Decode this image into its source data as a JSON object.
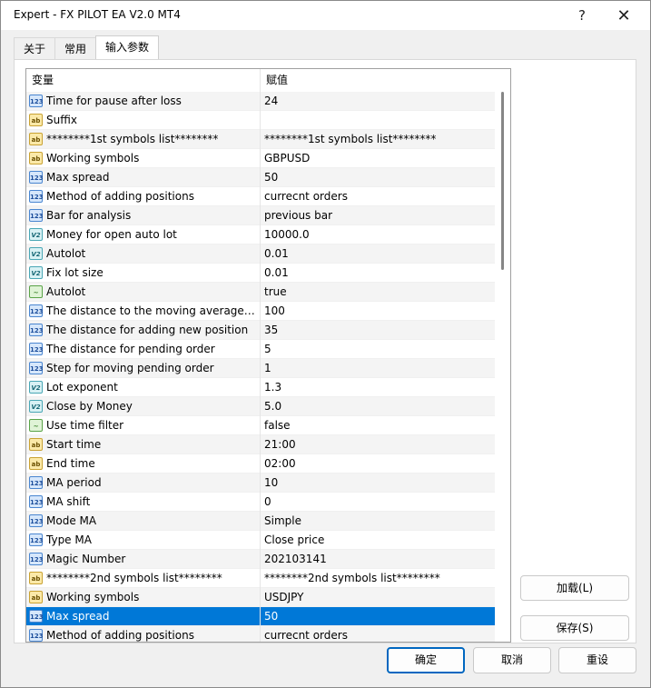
{
  "window": {
    "title": "Expert - FX PILOT EA V2.0 MT4",
    "help_glyph": "?",
    "close_glyph": "✕"
  },
  "tabs": [
    {
      "label": "关于"
    },
    {
      "label": "常用"
    },
    {
      "label": "输入参数"
    }
  ],
  "active_tab": 2,
  "grid": {
    "header": {
      "variable": "变量",
      "value": "赋值"
    },
    "selected_row": 27,
    "rows": [
      {
        "type": "int",
        "icon": "integer-type-icon",
        "name": "Time for pause after loss",
        "value": "24"
      },
      {
        "type": "str",
        "icon": "string-type-icon",
        "name": "Suffix",
        "value": ""
      },
      {
        "type": "str",
        "icon": "string-type-icon",
        "name": "********1st symbols list********",
        "value": "********1st symbols list********"
      },
      {
        "type": "str",
        "icon": "string-type-icon",
        "name": "Working symbols",
        "value": "GBPUSD"
      },
      {
        "type": "int",
        "icon": "integer-type-icon",
        "name": "Max spread",
        "value": "50"
      },
      {
        "type": "int",
        "icon": "integer-type-icon",
        "name": "Method of adding positions",
        "value": "currecnt orders"
      },
      {
        "type": "int",
        "icon": "integer-type-icon",
        "name": "Bar for analysis",
        "value": "previous bar"
      },
      {
        "type": "dbl",
        "icon": "double-type-icon",
        "name": "Money for open auto lot",
        "value": "10000.0"
      },
      {
        "type": "dbl",
        "icon": "double-type-icon",
        "name": "Autolot",
        "value": "0.01"
      },
      {
        "type": "dbl",
        "icon": "double-type-icon",
        "name": "Fix lot size",
        "value": "0.01"
      },
      {
        "type": "bool",
        "icon": "boolean-type-icon",
        "name": "Autolot",
        "value": "true"
      },
      {
        "type": "int",
        "icon": "integer-type-icon",
        "name": "The distance to the moving average o...",
        "value": "100"
      },
      {
        "type": "int",
        "icon": "integer-type-icon",
        "name": "The distance for adding new position",
        "value": "35"
      },
      {
        "type": "int",
        "icon": "integer-type-icon",
        "name": "The distance for pending order",
        "value": "5"
      },
      {
        "type": "int",
        "icon": "integer-type-icon",
        "name": "Step for moving pending order",
        "value": "1"
      },
      {
        "type": "dbl",
        "icon": "double-type-icon",
        "name": "Lot exponent",
        "value": "1.3"
      },
      {
        "type": "dbl",
        "icon": "double-type-icon",
        "name": "Close by Money",
        "value": "5.0"
      },
      {
        "type": "bool",
        "icon": "boolean-type-icon",
        "name": "Use time filter",
        "value": "false"
      },
      {
        "type": "str",
        "icon": "string-type-icon",
        "name": "Start time",
        "value": "21:00"
      },
      {
        "type": "str",
        "icon": "string-type-icon",
        "name": "End time",
        "value": "02:00"
      },
      {
        "type": "int",
        "icon": "integer-type-icon",
        "name": "MA period",
        "value": "10"
      },
      {
        "type": "int",
        "icon": "integer-type-icon",
        "name": "MA shift",
        "value": "0"
      },
      {
        "type": "int",
        "icon": "integer-type-icon",
        "name": "Mode MA",
        "value": "Simple"
      },
      {
        "type": "int",
        "icon": "integer-type-icon",
        "name": "Type MA",
        "value": "Close price"
      },
      {
        "type": "int",
        "icon": "integer-type-icon",
        "name": "Magic Number",
        "value": "202103141"
      },
      {
        "type": "str",
        "icon": "string-type-icon",
        "name": "********2nd symbols list********",
        "value": "********2nd symbols list********"
      },
      {
        "type": "str",
        "icon": "string-type-icon",
        "name": "Working symbols",
        "value": "USDJPY"
      },
      {
        "type": "int",
        "icon": "integer-type-icon",
        "name": "Max spread",
        "value": "50"
      },
      {
        "type": "int",
        "icon": "integer-type-icon",
        "name": "Method of adding positions",
        "value": "currecnt orders"
      }
    ]
  },
  "type_glyphs": {
    "int": "123",
    "str": "ab",
    "dbl": "V2",
    "bool": "~"
  },
  "buttons": {
    "load": "加载(L)",
    "save": "保存(S)",
    "ok": "确定",
    "cancel": "取消",
    "reset": "重设"
  },
  "colors": {
    "selection": "#0078d7",
    "ok_border": "#0067c0"
  }
}
